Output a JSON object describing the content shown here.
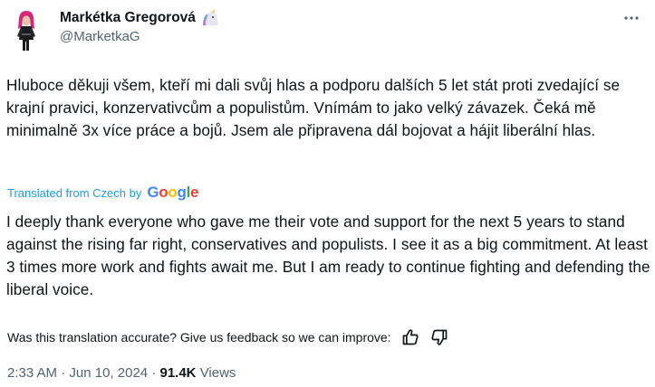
{
  "author": {
    "display_name": "Markétka Gregorová",
    "handle": "@MarketkaG",
    "emoji_icon": "unicorn-icon"
  },
  "tweet": {
    "original_text": "Hluboce děkuji všem, kteří mi dali svůj hlas a podporu dalších 5 let stát proti zvedající se krajní pravici, konzervativcům a populistům. Vnímám to jako velký závazek. Čeká mě minimalně 3x více práce a bojů. Jsem ale připravena dál bojovat a hájit liberální hlas.",
    "translated_from_label": "Translated from Czech by",
    "translation_provider": "Google",
    "translated_text": "I deeply thank everyone who gave me their vote and support for the next 5 years to stand against the rising far right, conservatives and populists. I see it as a big commitment. At least 3 times more work and fights await me. But I am ready to continue fighting and defending the liberal voice.",
    "feedback_prompt": "Was this translation accurate? Give us feedback so we can improve:"
  },
  "meta": {
    "time": "2:33 AM",
    "separator": "·",
    "date": "Jun 10, 2024",
    "views_count": "91.4K",
    "views_label": "Views"
  },
  "colors": {
    "link": "#1d9bf0",
    "text": "#0f1419",
    "secondary": "#536471"
  }
}
